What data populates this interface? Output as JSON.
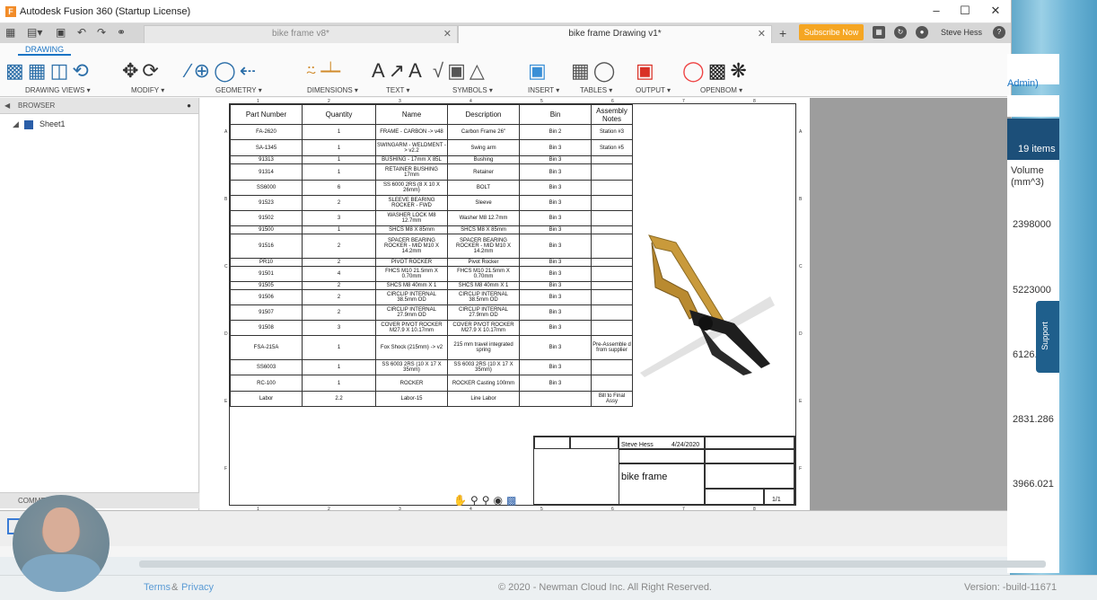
{
  "window": {
    "title": "Autodesk Fusion 360 (Startup License)",
    "app_icon": "F"
  },
  "tabs": [
    {
      "label": "bike frame v8*"
    },
    {
      "label": "bike frame Drawing v1*"
    }
  ],
  "header": {
    "subscribe_label": "Subscribe Now",
    "user_name": "Steve Hess"
  },
  "ribbon": {
    "active_tab": "DRAWING",
    "groups": [
      "DRAWING VIEWS ▾",
      "MODIFY ▾",
      "GEOMETRY ▾",
      "DIMENSIONS ▾",
      "TEXT ▾",
      "SYMBOLS ▾",
      "INSERT ▾",
      "TABLES ▾",
      "OUTPUT ▾",
      "OPENBOM ▾"
    ]
  },
  "browser": {
    "title": "BROWSER",
    "sheet": "Sheet1",
    "comments": "COMMENTS"
  },
  "bom": {
    "headers": [
      "Part Number",
      "Quantity",
      "Name",
      "Description",
      "Bin",
      "Assembly Notes"
    ],
    "rows": [
      [
        "FA-2620",
        "1",
        "FRAME - CARBON -> v48",
        "Carbon Frame 26\"",
        "Bin 2",
        "Station #3"
      ],
      [
        "SA-1345",
        "1",
        "SWINGARM - WELDMENT -> v2.2",
        "Swing arm",
        "Bin 3",
        "Station #5"
      ],
      [
        "91313",
        "1",
        "BUSHING - 17mm X 85L",
        "Bushing",
        "Bin 3",
        ""
      ],
      [
        "91314",
        "1",
        "RETAINER BUSHING 17mm",
        "Retainer",
        "Bin 3",
        ""
      ],
      [
        "SS6000",
        "6",
        "SS 6000 2RS (8 X 10 X 26mm)",
        "BOLT",
        "Bin 3",
        ""
      ],
      [
        "91523",
        "2",
        "SLEEVE BEARING ROCKER - FWD",
        "Sleeve",
        "Bin 3",
        ""
      ],
      [
        "91502",
        "3",
        "WASHER LOCK M8 12.7mm",
        "Washer M8 12.7mm",
        "Bin 3",
        ""
      ],
      [
        "91500",
        "1",
        "SHCS M8 X 85mm",
        "SHCS M8 X 85mm",
        "Bin 3",
        ""
      ],
      [
        "91516",
        "2",
        "SPACER BEARING ROCKER - MID M10 X 14.2mm",
        "SPACER BEARING ROCKER - MID M10 X 14.2mm",
        "Bin 3",
        ""
      ],
      [
        "PR10",
        "2",
        "PIVOT ROCKER",
        "Pivot Rocker",
        "Bin 3",
        ""
      ],
      [
        "91501",
        "4",
        "FHCS M10 21.5mm X 0.70mm",
        "FHCS M10 21.5mm X 0.70mm",
        "Bin 3",
        ""
      ],
      [
        "91505",
        "2",
        "SHCS M8 40mm X 1",
        "SHCS M8 40mm X 1",
        "Bin 3",
        ""
      ],
      [
        "91506",
        "2",
        "CIRCLIP INTERNAL 38.5mm OD",
        "CIRCLIP INTERNAL 38.5mm OD",
        "Bin 3",
        ""
      ],
      [
        "91507",
        "2",
        "CIRCLIP INTERNAL 27.9mm OD",
        "CIRCLIP INTERNAL 27.9mm OD",
        "Bin 3",
        ""
      ],
      [
        "91508",
        "3",
        "COVER PIVOT ROCKER M27.9 X 10.17mm",
        "COVER PIVOT ROCKER M27.9 X 10.17mm",
        "Bin 3",
        ""
      ],
      [
        "FSA-215A",
        "1",
        "Fox Shock (215mm) -> v2",
        "215 mm travel integrated spring",
        "Bin 3",
        "Pre-Assemble d from supplier"
      ],
      [
        "SS6003",
        "1",
        "SS 6003 2RS (10 X 17 X 35mm)",
        "SS 6003 2RS (10 X 17 X 35mm)",
        "Bin 3",
        ""
      ],
      [
        "RC-100",
        "1",
        "ROCKER",
        "ROCKER Casting 100mm",
        "Bin 3",
        ""
      ],
      [
        "Labor",
        "2.2",
        "Labor-15",
        "Line Labor",
        "",
        "Bill to Final Assy"
      ]
    ]
  },
  "titleblock": {
    "author": "Steve Hess",
    "date": "4/24/2020",
    "title": "bike frame",
    "sheet": "1/1"
  },
  "right_panel": {
    "filter": "Admin)",
    "items_count": "19 items",
    "volume_header": "Volume (mm^3)",
    "values": [
      "2398000",
      "5223000",
      "6126.",
      "2831.286",
      "3966.021"
    ],
    "support": "Support"
  },
  "footer": {
    "terms": "Terms",
    "amp": "&",
    "privacy": "Privacy",
    "copyright": "© 2020 - Newman Cloud Inc. All Right Reserved.",
    "version": "Version: -build-11671"
  },
  "colors": {
    "accent": "#1a74c4",
    "subscribe": "#f5a623",
    "frame": "#c99a3b"
  }
}
